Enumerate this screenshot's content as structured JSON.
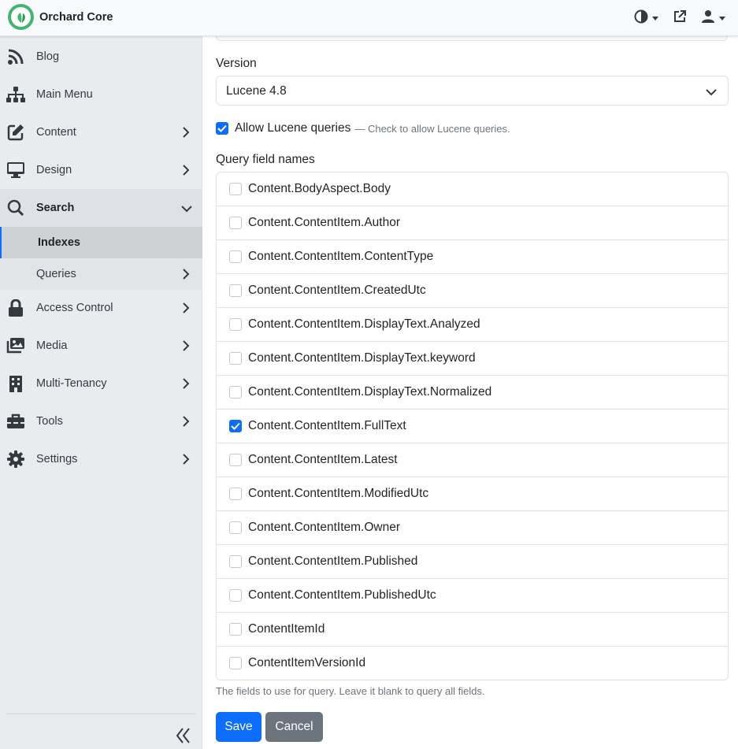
{
  "app": {
    "brand": "Orchard Core",
    "icons": [
      "theme-toggle-icon",
      "external-link-icon",
      "user-icon"
    ]
  },
  "sidebar": {
    "items": [
      {
        "label": "Blog",
        "icon": "rss-icon"
      },
      {
        "label": "Main Menu",
        "icon": "sitemap-icon"
      },
      {
        "label": "Content",
        "icon": "edit-icon"
      },
      {
        "label": "Design",
        "icon": "desktop-icon"
      },
      {
        "label": "Search",
        "icon": "search-icon",
        "expanded": true
      },
      {
        "label": "Access Control",
        "icon": "lock-icon"
      },
      {
        "label": "Media",
        "icon": "images-icon"
      },
      {
        "label": "Multi-Tenancy",
        "icon": "building-icon"
      },
      {
        "label": "Tools",
        "icon": "toolbox-icon"
      },
      {
        "label": "Settings",
        "icon": "gear-icon"
      }
    ],
    "search_children": [
      {
        "label": "Indexes",
        "selected": true
      },
      {
        "label": "Queries"
      }
    ]
  },
  "form": {
    "version_label": "Version",
    "version_value": "Lucene 4.8",
    "allow_label": "Allow Lucene queries",
    "allow_hint": "— Check to allow Lucene queries.",
    "allow_checked": true,
    "fields_label": "Query field names",
    "fields": [
      {
        "name": "Content.BodyAspect.Body",
        "checked": false
      },
      {
        "name": "Content.ContentItem.Author",
        "checked": false
      },
      {
        "name": "Content.ContentItem.ContentType",
        "checked": false
      },
      {
        "name": "Content.ContentItem.CreatedUtc",
        "checked": false
      },
      {
        "name": "Content.ContentItem.DisplayText.Analyzed",
        "checked": false
      },
      {
        "name": "Content.ContentItem.DisplayText.keyword",
        "checked": false
      },
      {
        "name": "Content.ContentItem.DisplayText.Normalized",
        "checked": false
      },
      {
        "name": "Content.ContentItem.FullText",
        "checked": true
      },
      {
        "name": "Content.ContentItem.Latest",
        "checked": false
      },
      {
        "name": "Content.ContentItem.ModifiedUtc",
        "checked": false
      },
      {
        "name": "Content.ContentItem.Owner",
        "checked": false
      },
      {
        "name": "Content.ContentItem.Published",
        "checked": false
      },
      {
        "name": "Content.ContentItem.PublishedUtc",
        "checked": false
      },
      {
        "name": "ContentItemId",
        "checked": false
      },
      {
        "name": "ContentItemVersionId",
        "checked": false
      }
    ],
    "fields_hint": "The fields to use for query. Leave it blank to query all fields.",
    "save_label": "Save",
    "cancel_label": "Cancel"
  },
  "colors": {
    "primary": "#0d6efd",
    "secondary": "#6c757d",
    "brand_green": "#41b670",
    "sidebar_bg": "#e9ecef"
  }
}
